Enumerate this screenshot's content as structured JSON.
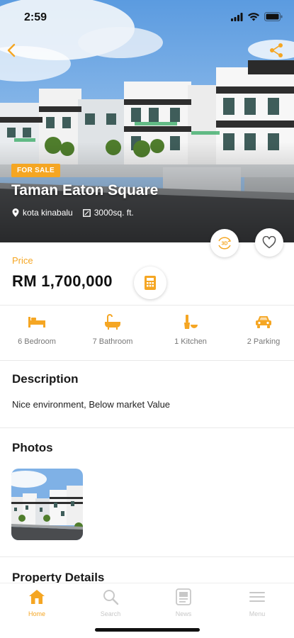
{
  "status_bar": {
    "time": "2:59"
  },
  "property": {
    "badge": "FOR SALE",
    "title": "Taman Eaton Square",
    "location": "kota kinabalu",
    "size": "3000sq. ft."
  },
  "price": {
    "label": "Price",
    "value": "RM 1,700,000"
  },
  "features": [
    {
      "icon": "bed-icon",
      "label": "6 Bedroom"
    },
    {
      "icon": "bathtub-icon",
      "label": "7 Bathroom"
    },
    {
      "icon": "kitchen-icon",
      "label": "1 Kitchen"
    },
    {
      "icon": "car-icon",
      "label": "2 Parking"
    }
  ],
  "description": {
    "title": "Description",
    "text": "Nice environment, Below market Value"
  },
  "photos": {
    "title": "Photos"
  },
  "property_details": {
    "title": "Property Details"
  },
  "tabbar": [
    {
      "icon": "home-icon",
      "label": "Home",
      "active": true
    },
    {
      "icon": "search-icon",
      "label": "Search",
      "active": false
    },
    {
      "icon": "news-icon",
      "label": "News",
      "active": false
    },
    {
      "icon": "menu-icon",
      "label": "Menu",
      "active": false
    }
  ],
  "colors": {
    "accent": "#f5a623",
    "inactive": "#c8c8c8"
  }
}
